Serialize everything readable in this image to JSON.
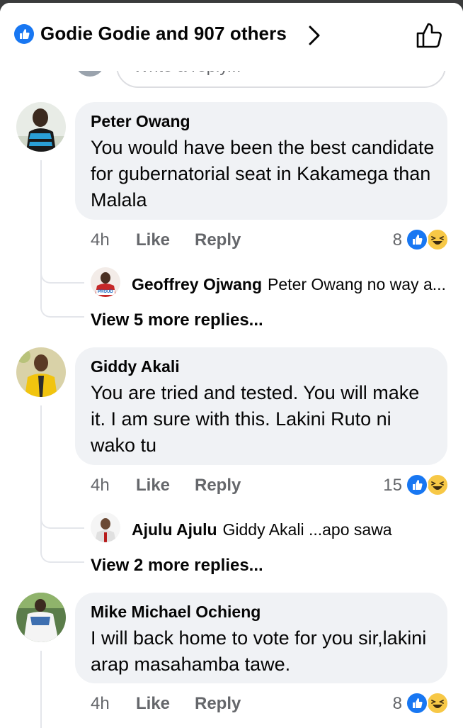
{
  "header": {
    "reactors_text": "Godie Godie and 907 others"
  },
  "reply_input": {
    "placeholder": "Write a reply..."
  },
  "comments": [
    {
      "author": "Peter Owang",
      "text": "You would have been the best candidate for gubernatorial seat in Kakamega than Malala",
      "time": "4h",
      "like_label": "Like",
      "reply_label": "Reply",
      "reaction_count": "8",
      "reply_preview": {
        "author": "Geoffrey Ojwang",
        "text": "Peter Owang no way a...",
        "avatar_badge": "PROUD"
      },
      "view_more": "View 5 more replies..."
    },
    {
      "author": "Giddy Akali",
      "text": "You are tried and tested. You will make it. I am sure with this. Lakini Ruto ni wako tu",
      "time": "4h",
      "like_label": "Like",
      "reply_label": "Reply",
      "reaction_count": "15",
      "reply_preview": {
        "author": "Ajulu Ajulu",
        "text": "Giddy Akali ...apo sawa"
      },
      "view_more": "View 2 more replies..."
    },
    {
      "author": "Mike Michael Ochieng",
      "text": "I will back home to vote for you sir,lakini arap masahamba tawe.",
      "time": "4h",
      "like_label": "Like",
      "reply_label": "Reply",
      "reaction_count": "8"
    }
  ],
  "colors": {
    "accent": "#1877f2",
    "bubble": "#f0f2f5",
    "secondary_text": "#65676b",
    "haha": "#f7c846"
  },
  "icons": [
    "like-badge-icon",
    "chevron-right-icon",
    "thumbs-up-outline-icon",
    "like-reaction-icon",
    "haha-reaction-icon"
  ]
}
